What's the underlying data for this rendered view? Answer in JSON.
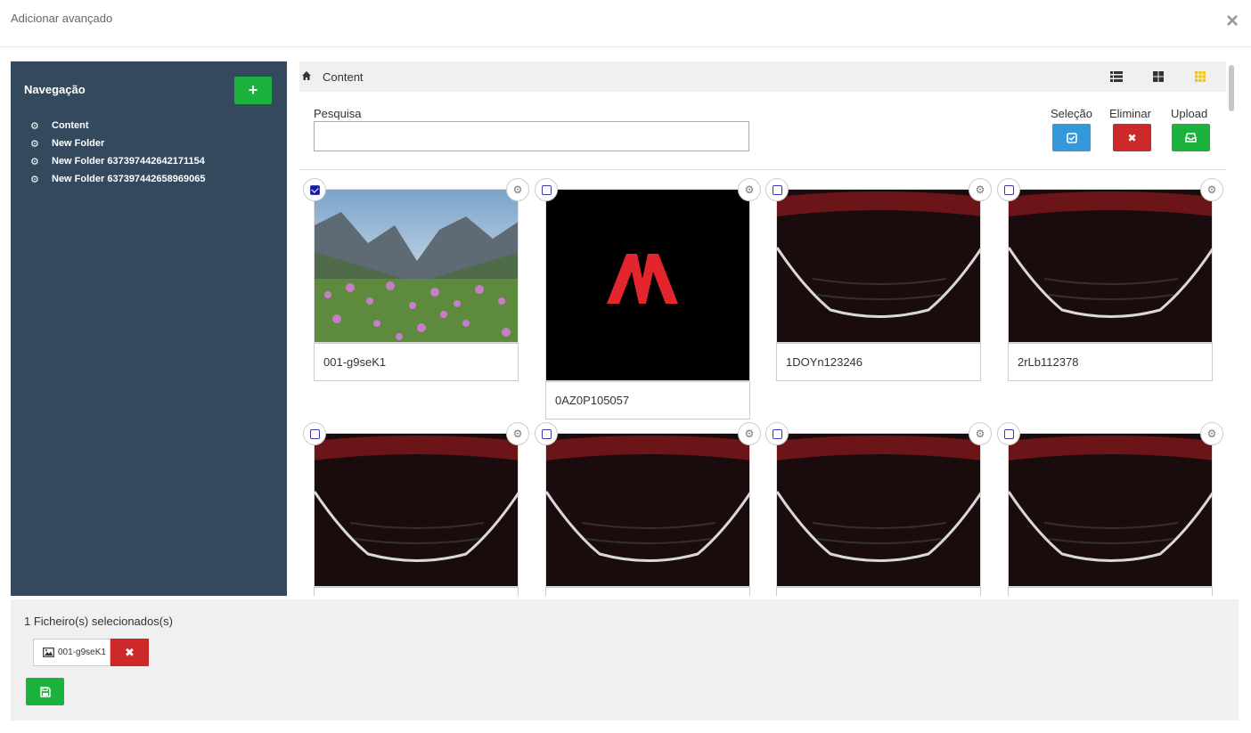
{
  "modal": {
    "title": "Adicionar avançado",
    "close_glyph": "×"
  },
  "sidebar": {
    "title": "Navegação",
    "add_glyph": "+",
    "items": [
      {
        "label": "Content",
        "icon": "gear-icon"
      },
      {
        "label": "New Folder",
        "icon": "gear-icon"
      },
      {
        "label": "New Folder 637397442642171154",
        "icon": "gear-icon"
      },
      {
        "label": "New Folder 637397442658969065",
        "icon": "gear-icon"
      }
    ]
  },
  "breadcrumb": {
    "current": "Content"
  },
  "toolbar": {
    "search_label": "Pesquisa",
    "search_value": "",
    "select_label": "Seleção",
    "delete_label": "Eliminar",
    "upload_label": "Upload",
    "delete_glyph": "✖"
  },
  "files": [
    {
      "name": "001-g9seK1",
      "checked": true,
      "kind": "landscape"
    },
    {
      "name": "0AZ0P105057",
      "checked": false,
      "kind": "logo"
    },
    {
      "name": "1DOYn123246",
      "checked": false,
      "kind": "car"
    },
    {
      "name": "2rLb112378",
      "checked": false,
      "kind": "car"
    },
    {
      "name": "",
      "checked": false,
      "kind": "car"
    },
    {
      "name": "",
      "checked": false,
      "kind": "car"
    },
    {
      "name": "",
      "checked": false,
      "kind": "car"
    },
    {
      "name": "",
      "checked": false,
      "kind": "car"
    }
  ],
  "footer": {
    "selected_count": "1 Ficheiro(s) selecionados(s)",
    "selected_file": "001-g9seK1",
    "remove_glyph": "✖"
  },
  "colors": {
    "accent_green": "#1bb33e",
    "accent_red": "#cc2a2a",
    "accent_blue": "#3498db",
    "sidebar_bg": "#34495e",
    "active_view": "#f1c40f"
  }
}
